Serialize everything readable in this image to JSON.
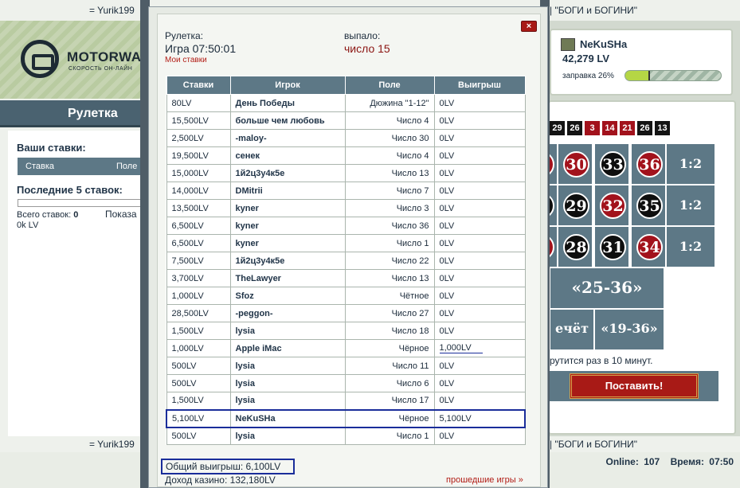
{
  "topbar": {
    "left_text": "= Yurik199",
    "right_text": "| \"БОГИ и БОГИНИ\""
  },
  "bottombar": {
    "left_text": "= Yurik199",
    "right_text": "| \"БОГИ и БОГИНИ\""
  },
  "footer": {
    "online_label": "Online:",
    "online_value": "107",
    "time_label": "Время:",
    "time_value": "07:50"
  },
  "logo": {
    "text": "MOTORWAR",
    "subtitle": "СКОРОСТЬ ОН-ЛАЙН"
  },
  "left_panel": {
    "title": "Рулетка",
    "your_bets_label": "Ваши ставки:",
    "bets_columns": [
      "Ставка",
      "Поле"
    ],
    "last5_label": "Последние 5 ставок:",
    "total_bets_label": "Всего ставок:",
    "total_bets_value": "0",
    "total_sum": "0k LV",
    "show_link": "Показа"
  },
  "right_panel": {
    "user_name": "NeKuSHa",
    "user_lv": "42,279 LV",
    "refuel_label": "заправка 26%",
    "refuel_percent": 26,
    "recent_numbers": [
      {
        "n": "29",
        "color": "black"
      },
      {
        "n": "26",
        "color": "black"
      },
      {
        "n": "3",
        "color": "red"
      },
      {
        "n": "14",
        "color": "red"
      },
      {
        "n": "21",
        "color": "red"
      },
      {
        "n": "26",
        "color": "black"
      },
      {
        "n": "13",
        "color": "black"
      }
    ],
    "grid_numbers": [
      {
        "n": "30",
        "color": "red"
      },
      {
        "n": "33",
        "color": "black"
      },
      {
        "n": "36",
        "color": "red"
      },
      {
        "n": "29",
        "color": "black"
      },
      {
        "n": "32",
        "color": "red"
      },
      {
        "n": "35",
        "color": "black"
      },
      {
        "n": "28",
        "color": "black"
      },
      {
        "n": "31",
        "color": "black"
      },
      {
        "n": "34",
        "color": "red"
      }
    ],
    "ratio_labels": [
      "1:2",
      "1:2",
      "1:2"
    ],
    "dozen_label": "«25-36»",
    "odd_label": "ечёт",
    "range_label": "«19-36»",
    "spin_note": "рутится раз в 10 минут.",
    "place_bet_label": "Поставить!"
  },
  "modal": {
    "close_label": "×",
    "roulette_label": "Рулетка:",
    "game_label": "Игра 07:50:01",
    "my_bets_link": "Мои ставки",
    "dropped_label": "выпало:",
    "dropped_value": "число 15",
    "columns": [
      "Ставки",
      "Игрок",
      "Поле",
      "Выигрыш"
    ],
    "rows": [
      {
        "stake": "80LV",
        "player": "День Победы",
        "field": "Дюжина \"1-12\"",
        "win": "0LV"
      },
      {
        "stake": "15,500LV",
        "player": "больше чем любовь",
        "field": "Число 4",
        "win": "0LV"
      },
      {
        "stake": "2,500LV",
        "player": "-maloy-",
        "field": "Число 30",
        "win": "0LV"
      },
      {
        "stake": "19,500LV",
        "player": "сенек",
        "field": "Число 4",
        "win": "0LV"
      },
      {
        "stake": "15,000LV",
        "player": "1й2ц3у4к5е",
        "field": "Число 13",
        "win": "0LV"
      },
      {
        "stake": "14,000LV",
        "player": "DMitrii",
        "field": "Число 7",
        "win": "0LV"
      },
      {
        "stake": "13,500LV",
        "player": "kyner",
        "field": "Число 3",
        "win": "0LV"
      },
      {
        "stake": "6,500LV",
        "player": "kyner",
        "field": "Число 36",
        "win": "0LV"
      },
      {
        "stake": "6,500LV",
        "player": "kyner",
        "field": "Число 1",
        "win": "0LV"
      },
      {
        "stake": "7,500LV",
        "player": "1й2ц3у4к5е",
        "field": "Число 22",
        "win": "0LV"
      },
      {
        "stake": "3,700LV",
        "player": "TheLawyer",
        "field": "Число 13",
        "win": "0LV"
      },
      {
        "stake": "1,000LV",
        "player": "Sfoz",
        "field": "Чётное",
        "win": "0LV"
      },
      {
        "stake": "28,500LV",
        "player": "-peggon-",
        "field": "Число 27",
        "win": "0LV"
      },
      {
        "stake": "1,500LV",
        "player": "lysia",
        "field": "Число 18",
        "win": "0LV"
      },
      {
        "stake": "1,000LV",
        "player": "Apple iMac",
        "field": "Чёрное",
        "win": "1,000LV"
      },
      {
        "stake": "500LV",
        "player": "lysia",
        "field": "Число 11",
        "win": "0LV"
      },
      {
        "stake": "500LV",
        "player": "lysia",
        "field": "Число 6",
        "win": "0LV"
      },
      {
        "stake": "1,500LV",
        "player": "lysia",
        "field": "Число 17",
        "win": "0LV"
      },
      {
        "stake": "5,100LV",
        "player": "NeKuSHa",
        "field": "Чёрное",
        "win": "5,100LV"
      },
      {
        "stake": "500LV",
        "player": "lysia",
        "field": "Число 1",
        "win": "0LV"
      }
    ],
    "total_win": "Общий выигрыш: 6,100LV",
    "casino_income": "Доход казино: 132,180LV",
    "past_games_link": "прошедшие игры »"
  }
}
